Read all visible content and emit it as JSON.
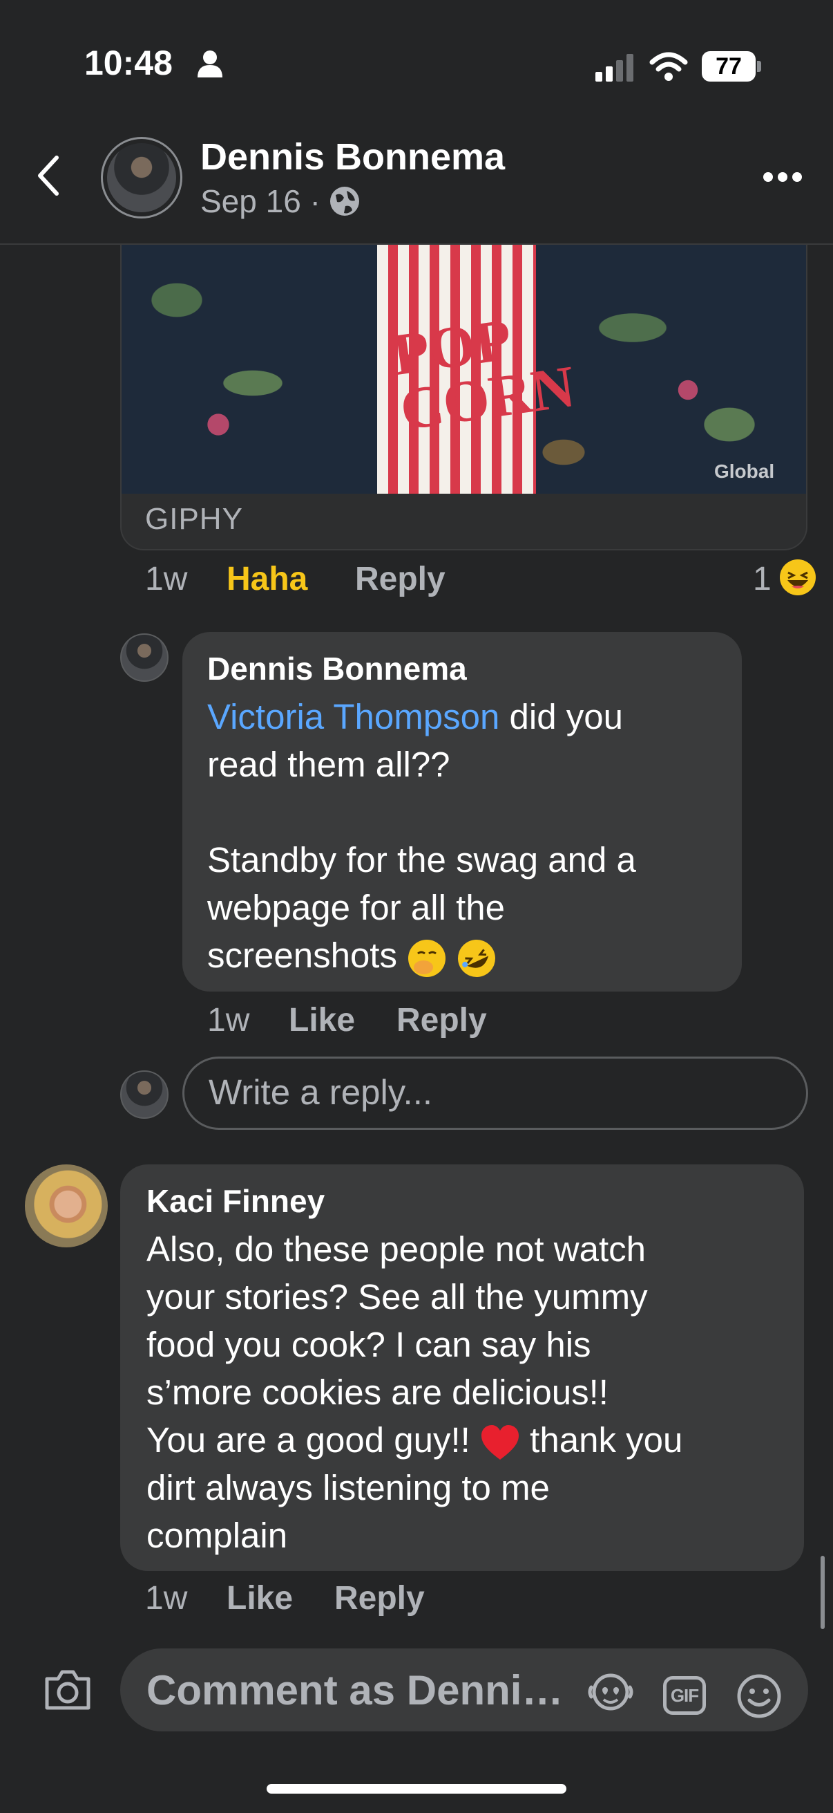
{
  "status_bar": {
    "time": "10:48",
    "battery": "77"
  },
  "header": {
    "author": "Dennis Bonnema",
    "date": "Sep 16 ·"
  },
  "giphy": {
    "label": "GIPHY",
    "watermark": "Global",
    "bag_text_1": "POP",
    "bag_text_2": "CORN"
  },
  "giphy_actions": {
    "time": "1w",
    "reaction_label": "Haha",
    "reply": "Reply",
    "reaction_count": "1"
  },
  "reply_comment": {
    "author": "Dennis Bonnema",
    "mention": "Victoria Thompson",
    "line1_rest": " did you",
    "line2": "read them all??",
    "line3": "Standby for the swag and a",
    "line4": "webpage for all the",
    "line5": "screenshots",
    "time": "1w",
    "like": "Like",
    "reply": "Reply"
  },
  "reply_box": {
    "placeholder": "Write a reply..."
  },
  "kaci_comment": {
    "author": "Kaci Finney",
    "lines": [
      "Also, do these people not watch",
      "your stories?  See all the yummy",
      "food you cook? I can say his",
      "s’more cookies are delicious!!",
      "You are a good guy!! ",
      "dirt always listening to me",
      "complain"
    ],
    "line5_rest": " thank you",
    "time": "1w",
    "like": "Like",
    "reply": "Reply"
  },
  "composer": {
    "placeholder": "Comment as Denni…",
    "gif_label": "GIF"
  },
  "colors": {
    "background": "#242526",
    "bubble": "#3a3b3c",
    "mention": "#5aa7ff",
    "haha": "#f7c619",
    "muted": "#b0b3b8"
  }
}
